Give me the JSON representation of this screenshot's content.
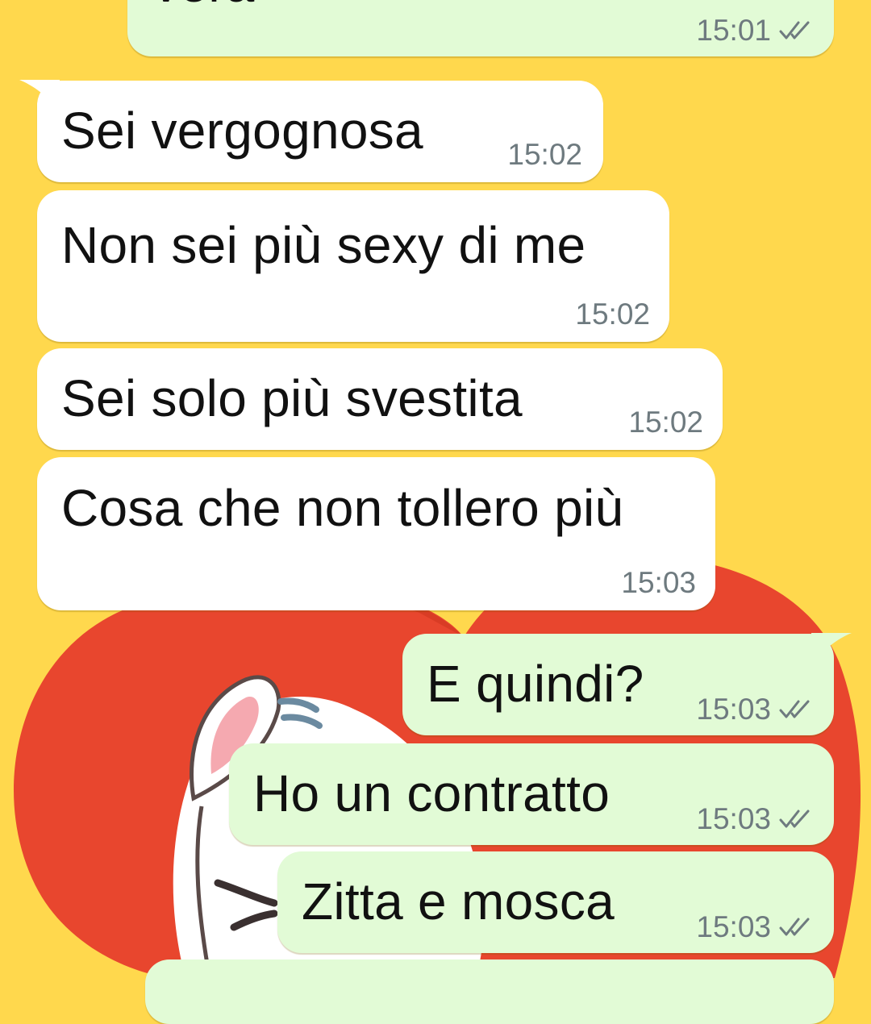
{
  "theme": {
    "wallpaper_background": "#ffd84d",
    "heart_color": "#e8462e",
    "incoming_bubble": "#ffffff",
    "outgoing_bubble": "#e2fbd6",
    "timestamp_color": "#6e7a7f",
    "tick_color": "#6e7a7f"
  },
  "messages": [
    {
      "direction": "outgoing",
      "text": "vera",
      "time": "15:01",
      "status_icon": "double-check-icon"
    },
    {
      "direction": "incoming",
      "text": "Sei vergognosa",
      "time": "15:02"
    },
    {
      "direction": "incoming",
      "text": "Non sei più sexy di me",
      "time": "15:02"
    },
    {
      "direction": "incoming",
      "text": "Sei solo più svestita",
      "time": "15:02"
    },
    {
      "direction": "incoming",
      "text": "Cosa che non tollero più",
      "time": "15:03"
    },
    {
      "direction": "outgoing",
      "text": "E quindi?",
      "time": "15:03",
      "status_icon": "double-check-icon"
    },
    {
      "direction": "outgoing",
      "text": "Ho un contratto",
      "time": "15:03",
      "status_icon": "double-check-icon"
    },
    {
      "direction": "outgoing",
      "text": "Zitta e mosca",
      "time": "15:03",
      "status_icon": "double-check-icon"
    },
    {
      "direction": "outgoing",
      "text": "",
      "time": "",
      "status_icon": ""
    }
  ]
}
